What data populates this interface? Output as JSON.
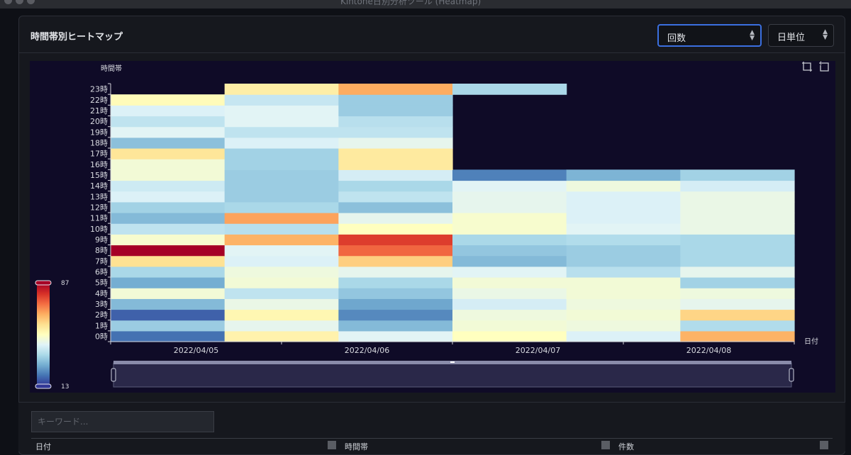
{
  "window": {
    "title": "Kintone日別分析ツール (Heatmap)"
  },
  "panel": {
    "title": "時間帯別ヒートマップ"
  },
  "controls": {
    "metric": {
      "selected": "回数"
    },
    "unit": {
      "selected": "日単位"
    }
  },
  "search": {
    "placeholder": "キーワード..."
  },
  "table": {
    "headers": [
      "日付",
      "時間帯",
      "件数"
    ]
  },
  "icons": {
    "toolbox": [
      "zoom-icon",
      "zoom-reset-icon"
    ],
    "sort": "sort-icon"
  },
  "chart_data": {
    "type": "heatmap",
    "ylabel": "時間帯",
    "xlabel": "日付",
    "x_categories": [
      "2022/04/05",
      "2022/04/06",
      "2022/04/07",
      "2022/04/08"
    ],
    "y_categories": [
      "0時",
      "1時",
      "2時",
      "3時",
      "4時",
      "5時",
      "6時",
      "7時",
      "8時",
      "9時",
      "10時",
      "11時",
      "12時",
      "13時",
      "14時",
      "15時",
      "16時",
      "17時",
      "18時",
      "19時",
      "20時",
      "21時",
      "22時",
      "23時"
    ],
    "visual_map": {
      "min": 13,
      "max": 87,
      "min_label": "13",
      "max_label": "87",
      "colors": [
        "#313695",
        "#4575b4",
        "#74add1",
        "#abd9e9",
        "#e0f3f8",
        "#ffffbf",
        "#fee090",
        "#fdae61",
        "#f46d43",
        "#d73027",
        "#a50026"
      ]
    },
    "values": [
      [
        20,
        53,
        43,
        50,
        42,
        64
      ],
      [
        33,
        44,
        30,
        47,
        46,
        36
      ],
      [
        18,
        52,
        23,
        46,
        47,
        59
      ],
      [
        30,
        45,
        27,
        41,
        46,
        44
      ],
      [
        47,
        38,
        32,
        45,
        47,
        46
      ],
      [
        28,
        47,
        35,
        47,
        47,
        34
      ],
      [
        35,
        46,
        44,
        43,
        37,
        44
      ],
      [
        57,
        42,
        60,
        30,
        33,
        35
      ],
      [
        87,
        43,
        73,
        32,
        33,
        35
      ],
      [
        48,
        64,
        78,
        35,
        36,
        35
      ],
      [
        38,
        37,
        50,
        48,
        43,
        45
      ],
      [
        30,
        66,
        44,
        48,
        42,
        45
      ],
      [
        34,
        35,
        31,
        44,
        42,
        45
      ],
      [
        42,
        33,
        38,
        44,
        42,
        45
      ],
      [
        40,
        33,
        35,
        43,
        46,
        41
      ],
      [
        47,
        33,
        41,
        22,
        29,
        34
      ],
      [
        47,
        34,
        55,
        null,
        null,
        null
      ],
      [
        56,
        34,
        55,
        null,
        null,
        null
      ],
      [
        31,
        42,
        44,
        null,
        null,
        null
      ],
      [
        43,
        38,
        38,
        null,
        null,
        null
      ],
      [
        38,
        43,
        37,
        null,
        null,
        null
      ],
      [
        42,
        43,
        33,
        null,
        null,
        null
      ],
      [
        51,
        39,
        33,
        null,
        null,
        null
      ],
      [
        null,
        54,
        65,
        35,
        null,
        null
      ]
    ]
  }
}
